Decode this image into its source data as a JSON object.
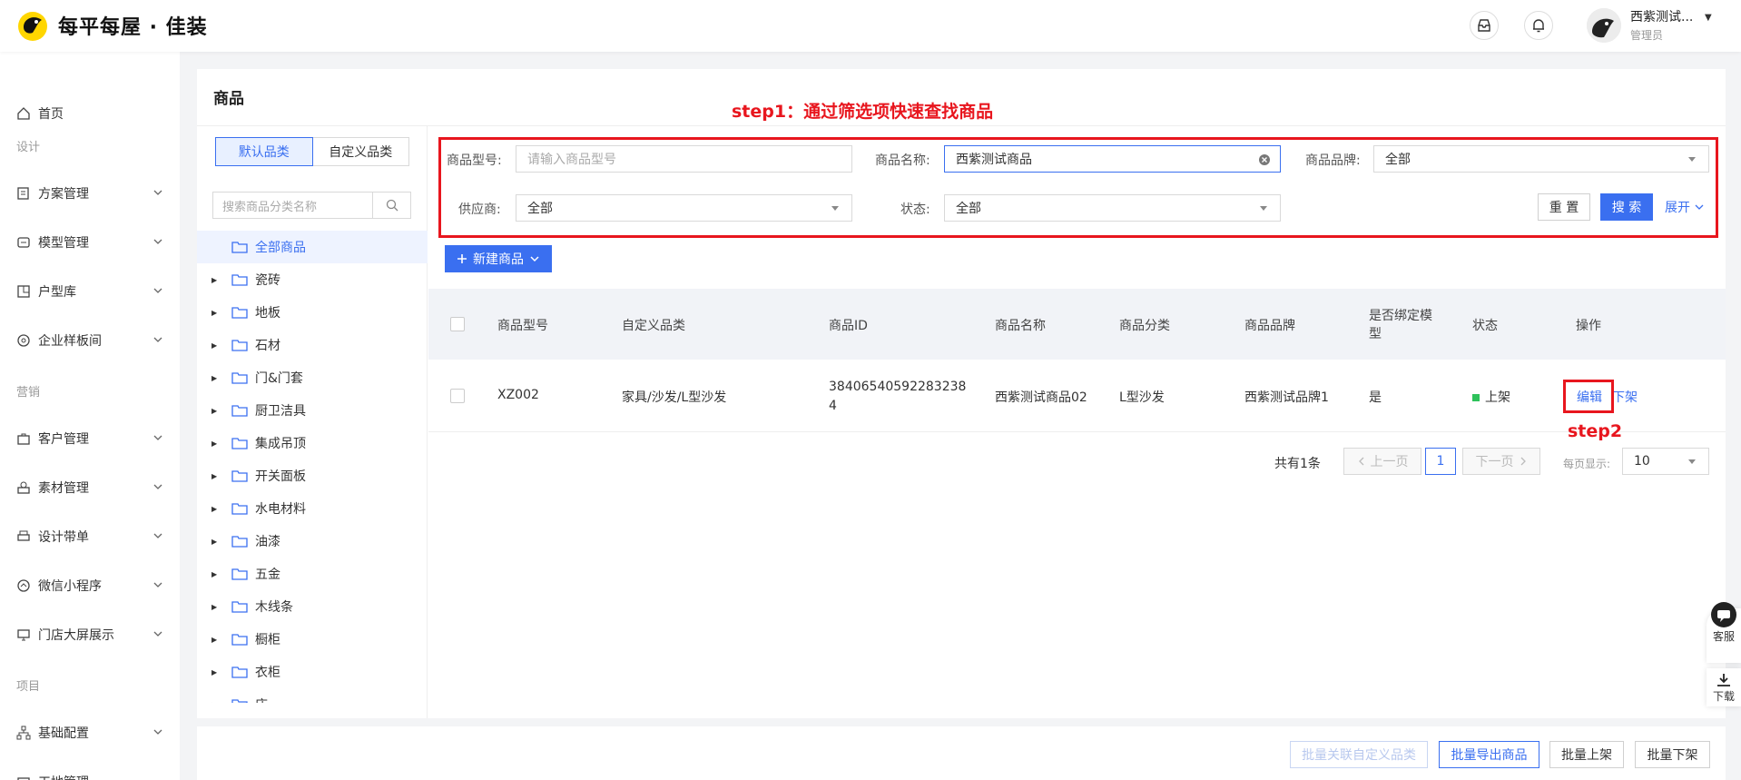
{
  "header": {
    "brand": "每平每屋 · 佳装",
    "user_name": "西紫测试...",
    "user_role": "管理员"
  },
  "sidebar": {
    "items": [
      {
        "label": "首页"
      },
      {
        "label": "方案管理"
      },
      {
        "label": "模型管理"
      },
      {
        "label": "户型库"
      },
      {
        "label": "企业样板间"
      },
      {
        "label": "客户管理"
      },
      {
        "label": "素材管理"
      },
      {
        "label": "设计带单"
      },
      {
        "label": "微信小程序"
      },
      {
        "label": "门店大屏展示"
      },
      {
        "label": "基础配置"
      },
      {
        "label": "工地管理"
      }
    ],
    "sections": [
      "设计",
      "营销",
      "项目"
    ]
  },
  "page": {
    "title": "商品",
    "step1": "step1：通过筛选项快速查找商品",
    "step2": "step2"
  },
  "category": {
    "tab_default": "默认品类",
    "tab_custom": "自定义品类",
    "search_placeholder": "搜索商品分类名称",
    "tree": [
      "全部商品",
      "瓷砖",
      "地板",
      "石材",
      "门&门套",
      "厨卫洁具",
      "集成吊顶",
      "开关面板",
      "水电材料",
      "油漆",
      "五金",
      "木线条",
      "橱柜",
      "衣柜",
      "床"
    ]
  },
  "filters": {
    "model_label": "商品型号:",
    "model_placeholder": "请输入商品型号",
    "name_label": "商品名称:",
    "name_value": "西紫测试商品",
    "brand_label": "商品品牌:",
    "brand_value": "全部",
    "supplier_label": "供应商:",
    "supplier_value": "全部",
    "status_label": "状态:",
    "status_value": "全部",
    "reset": "重 置",
    "search": "搜 索",
    "expand": "展开"
  },
  "toolbar": {
    "new_product": "新建商品"
  },
  "table": {
    "headers": [
      "商品型号",
      "自定义品类",
      "商品ID",
      "商品名称",
      "商品分类",
      "商品品牌",
      "是否绑定模型",
      "状态",
      "操作"
    ],
    "row": {
      "model": "XZ002",
      "custom_category": "家具/沙发/L型沙发",
      "id_line1": "38406540592283238",
      "id_line2": "4",
      "name": "西紫测试商品02",
      "category": "L型沙发",
      "brand": "西紫测试品牌1",
      "bound": "是",
      "status": "上架",
      "action_edit": "编辑",
      "action_off": "下架"
    }
  },
  "pagination": {
    "total": "共有1条",
    "prev": "上一页",
    "current": "1",
    "next": "下一页",
    "size_label": "每页显示:",
    "size_value": "10"
  },
  "bottom": {
    "batch_link": "批量关联自定义品类",
    "batch_export": "批量导出商品",
    "batch_on": "批量上架",
    "batch_off": "批量下架"
  },
  "float": {
    "service": "客服",
    "download": "下载"
  },
  "colors": {
    "primary": "#3a6ff0",
    "annotation": "#e8161e",
    "status_on": "#2ec25b"
  }
}
